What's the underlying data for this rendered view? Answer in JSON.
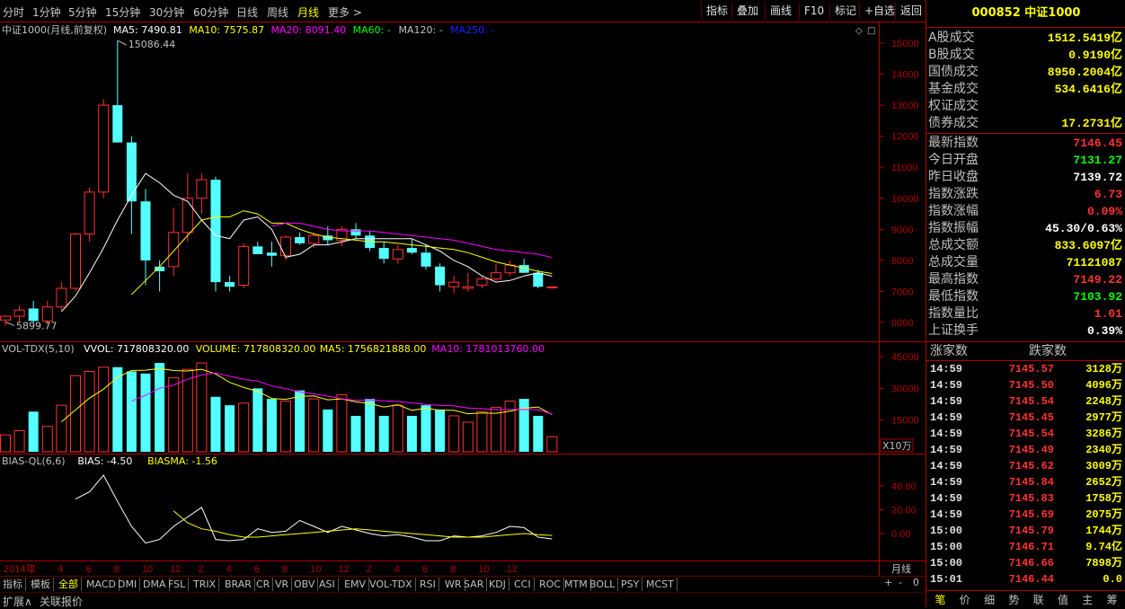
{
  "periods": [
    "分时",
    "1分钟",
    "5分钟",
    "15分钟",
    "30分钟",
    "60分钟",
    "日线",
    "周线",
    "月线",
    "更多"
  ],
  "active_period": "月线",
  "more_arrow": ">",
  "toolbar": [
    "指标",
    "叠加",
    "画线",
    "F10",
    "标记",
    "+自选",
    "返回"
  ],
  "chart": {
    "title": "中证1000(月线,前复权)",
    "ma_legend": [
      {
        "text": "MA5: 7490.81",
        "color": "#ffffff"
      },
      {
        "text": "MA10: 7575.87",
        "color": "#ffff00"
      },
      {
        "text": "MA20: 8091.40",
        "color": "#ff00ff"
      },
      {
        "text": "MA60: -",
        "color": "#00ff00"
      },
      {
        "text": "MA120: -",
        "color": "#c0c0c0"
      },
      {
        "text": "MA250: -",
        "color": "#2020ff"
      }
    ],
    "price_axis": [
      "15000",
      "14000",
      "13000",
      "12000",
      "11000",
      "10000",
      "9000",
      "8000",
      "7000",
      "6000"
    ],
    "high_label": "15086.44",
    "low_label": "5899.77",
    "vol_legend": [
      {
        "text": "VOL-TDX(5,10)",
        "color": "#c0c0c0"
      },
      {
        "text": "VVOL: 717808320.00",
        "color": "#ffffff"
      },
      {
        "text": "VOLUME: 717808320.00",
        "color": "#ffff00"
      },
      {
        "text": "MA5: 1756821888.00",
        "color": "#ffff00"
      },
      {
        "text": "MA10: 1781013760.00",
        "color": "#ff00ff"
      }
    ],
    "vol_axis": [
      "45000",
      "30000",
      "15000"
    ],
    "vol_unit": "X10万",
    "bias_legend": [
      {
        "text": "BIAS-QL(6,6)",
        "color": "#c0c0c0"
      },
      {
        "text": "BIAS: -4.50",
        "color": "#ffffff"
      },
      {
        "text": "BIASMA: -1.56",
        "color": "#ffff00"
      }
    ],
    "bias_axis": [
      "40.00",
      "20.00",
      "0.00"
    ],
    "x_axis": [
      "2014年",
      "2",
      "4",
      "6",
      "8",
      "10",
      "12",
      "2",
      "4",
      "6",
      "8",
      "10",
      "12",
      "2",
      "4",
      "6",
      "8",
      "10",
      "12"
    ],
    "period_label": "月线",
    "zoom_controls": [
      "+",
      "-",
      "0"
    ]
  },
  "chart_data": {
    "type": "candlestick",
    "title": "中证1000(月线,前复权)",
    "candles": [
      {
        "o": 6080,
        "h": 6250,
        "l": 5900,
        "c": 6200
      },
      {
        "o": 6200,
        "h": 6550,
        "l": 6000,
        "c": 6400
      },
      {
        "o": 6450,
        "h": 6700,
        "l": 6000,
        "c": 6050
      },
      {
        "o": 6050,
        "h": 6700,
        "l": 5950,
        "c": 6500
      },
      {
        "o": 6500,
        "h": 7300,
        "l": 6400,
        "c": 7100
      },
      {
        "o": 7100,
        "h": 8900,
        "l": 7000,
        "c": 8850
      },
      {
        "o": 8850,
        "h": 10350,
        "l": 8600,
        "c": 10200
      },
      {
        "o": 10200,
        "h": 13200,
        "l": 10000,
        "c": 13000
      },
      {
        "o": 13000,
        "h": 15086,
        "l": 11800,
        "c": 11800
      },
      {
        "o": 11800,
        "h": 12000,
        "l": 8850,
        "c": 9900
      },
      {
        "o": 9900,
        "h": 10300,
        "l": 7200,
        "c": 8000
      },
      {
        "o": 7800,
        "h": 8000,
        "l": 7000,
        "c": 7650
      },
      {
        "o": 7800,
        "h": 9700,
        "l": 7500,
        "c": 8900
      },
      {
        "o": 8900,
        "h": 10800,
        "l": 8600,
        "c": 10000
      },
      {
        "o": 10000,
        "h": 10800,
        "l": 9500,
        "c": 10600
      },
      {
        "o": 10600,
        "h": 10700,
        "l": 7000,
        "c": 7300
      },
      {
        "o": 7300,
        "h": 7500,
        "l": 7000,
        "c": 7150
      },
      {
        "o": 7200,
        "h": 8550,
        "l": 7100,
        "c": 8450
      },
      {
        "o": 8450,
        "h": 8600,
        "l": 8200,
        "c": 8200
      },
      {
        "o": 8250,
        "h": 8600,
        "l": 7800,
        "c": 8150
      },
      {
        "o": 8150,
        "h": 8800,
        "l": 8000,
        "c": 8750
      },
      {
        "o": 8750,
        "h": 8900,
        "l": 8500,
        "c": 8550
      },
      {
        "o": 8550,
        "h": 8900,
        "l": 8400,
        "c": 8800
      },
      {
        "o": 8800,
        "h": 9100,
        "l": 8500,
        "c": 8650
      },
      {
        "o": 8650,
        "h": 9100,
        "l": 8450,
        "c": 9000
      },
      {
        "o": 9000,
        "h": 9200,
        "l": 8700,
        "c": 8800
      },
      {
        "o": 8800,
        "h": 8950,
        "l": 8300,
        "c": 8400
      },
      {
        "o": 8400,
        "h": 8600,
        "l": 7900,
        "c": 8050
      },
      {
        "o": 8050,
        "h": 8500,
        "l": 7900,
        "c": 8350
      },
      {
        "o": 8400,
        "h": 8700,
        "l": 8200,
        "c": 8250
      },
      {
        "o": 8250,
        "h": 8500,
        "l": 7700,
        "c": 7800
      },
      {
        "o": 7800,
        "h": 7900,
        "l": 7000,
        "c": 7200
      },
      {
        "o": 7150,
        "h": 7500,
        "l": 6950,
        "c": 7300
      },
      {
        "o": 7100,
        "h": 7600,
        "l": 7000,
        "c": 7150
      },
      {
        "o": 7200,
        "h": 7500,
        "l": 7100,
        "c": 7400
      },
      {
        "o": 7400,
        "h": 7900,
        "l": 7300,
        "c": 7600
      },
      {
        "o": 7600,
        "h": 8000,
        "l": 7500,
        "c": 7850
      },
      {
        "o": 7850,
        "h": 8050,
        "l": 7600,
        "c": 7600
      },
      {
        "o": 7600,
        "h": 7700,
        "l": 7100,
        "c": 7150
      },
      {
        "o": 7140,
        "h": 7149,
        "l": 7104,
        "c": 7146
      }
    ],
    "ma5": [
      null,
      null,
      null,
      null,
      6350,
      6850,
      7600,
      8400,
      9300,
      10100,
      10800,
      10500,
      10100,
      9900,
      9300,
      8800,
      8700,
      9300,
      9400,
      9000,
      8100,
      8200,
      8500,
      8500,
      8600,
      8700,
      8700,
      8700,
      8700,
      8700,
      8500,
      8300,
      8000,
      7800,
      7500,
      7300,
      7350,
      7500,
      7600,
      7490
    ],
    "ma10": [
      null,
      null,
      null,
      null,
      null,
      null,
      null,
      null,
      null,
      6900,
      7350,
      7800,
      8300,
      8800,
      9300,
      9400,
      9400,
      9600,
      9500,
      9200,
      9200,
      9000,
      8850,
      8750,
      8700,
      8650,
      8600,
      8600,
      8550,
      8500,
      8450,
      8400,
      8350,
      8250,
      8100,
      7950,
      7850,
      7750,
      7650,
      7576
    ],
    "ma20": [
      null,
      null,
      null,
      null,
      null,
      null,
      null,
      null,
      null,
      null,
      null,
      null,
      null,
      null,
      null,
      null,
      null,
      null,
      null,
      9100,
      9200,
      9200,
      9100,
      9000,
      8950,
      8950,
      8950,
      8900,
      8850,
      8800,
      8750,
      8700,
      8650,
      8550,
      8450,
      8350,
      8300,
      8250,
      8200,
      8091
    ],
    "volume": [
      8000,
      10000,
      19000,
      12000,
      22000,
      36000,
      38000,
      40000,
      40000,
      38000,
      37000,
      42000,
      35000,
      39000,
      42000,
      26000,
      22000,
      23000,
      30000,
      25000,
      24000,
      29000,
      25000,
      20000,
      27000,
      17000,
      25000,
      17000,
      22000,
      17000,
      22000,
      20000,
      17000,
      14000,
      19000,
      21000,
      24000,
      25000,
      17000,
      7200
    ],
    "vol_ma5": [
      null,
      null,
      null,
      null,
      14200,
      19800,
      25400,
      29600,
      35200,
      38400,
      38600,
      39400,
      38400,
      38200,
      39000,
      36800,
      32800,
      30400,
      28600,
      25200,
      24800,
      26200,
      26400,
      24600,
      25000,
      23600,
      22800,
      21200,
      22200,
      19600,
      20600,
      19600,
      19600,
      18000,
      18400,
      18200,
      19200,
      20600,
      21200,
      17568
    ],
    "vol_ma10": [
      null,
      null,
      null,
      null,
      null,
      null,
      null,
      null,
      null,
      23900,
      26800,
      30000,
      31600,
      34300,
      36300,
      37300,
      35700,
      34300,
      33400,
      31100,
      29800,
      28300,
      27400,
      26300,
      25100,
      24300,
      24600,
      24100,
      23800,
      23100,
      22400,
      22000,
      21700,
      20700,
      20400,
      19900,
      20000,
      20100,
      19900,
      17810
    ],
    "bias": [
      null,
      null,
      null,
      null,
      null,
      29,
      35,
      49,
      27,
      6,
      -8,
      -5,
      6,
      14,
      22,
      -5,
      -6,
      -5,
      4,
      1,
      2,
      11,
      6,
      1,
      6,
      3,
      0,
      -2,
      -1,
      -3,
      -6,
      -6,
      -2,
      -3,
      -2,
      1,
      6,
      5,
      -3,
      -4.5
    ],
    "biasma": [
      null,
      null,
      null,
      null,
      null,
      null,
      null,
      null,
      null,
      null,
      null,
      null,
      19,
      9,
      4,
      2,
      -1,
      -3,
      -3,
      -2,
      -1,
      0,
      1,
      2,
      3,
      4,
      3,
      2,
      1,
      0,
      -1,
      -2,
      -3,
      -3,
      -3,
      -2,
      -1,
      0,
      -1,
      -1.56
    ]
  },
  "right_panel": {
    "title": "000852 中证1000",
    "turnover": [
      {
        "label": "A股成交",
        "value": "1512.5419亿",
        "color": "#ffff00"
      },
      {
        "label": "B股成交",
        "value": "0.9190亿",
        "color": "#ffff00"
      },
      {
        "label": "国债成交",
        "value": "8950.2004亿",
        "color": "#ffff00"
      },
      {
        "label": "基金成交",
        "value": "534.6416亿",
        "color": "#ffff00"
      },
      {
        "label": "权证成交",
        "value": "",
        "color": "#ffff00"
      },
      {
        "label": "债券成交",
        "value": "17.2731亿",
        "color": "#ffff00"
      }
    ],
    "quotes": [
      {
        "label": "最新指数",
        "value": "7146.45",
        "color": "#ff3232"
      },
      {
        "label": "今日开盘",
        "value": "7131.27",
        "color": "#00ff00"
      },
      {
        "label": "昨日收盘",
        "value": "7139.72",
        "color": "#ffffff"
      },
      {
        "label": "指数涨跌",
        "value": "6.73",
        "color": "#ff3232"
      },
      {
        "label": "指数涨幅",
        "value": "0.09%",
        "color": "#ff3232"
      },
      {
        "label": "指数振幅",
        "value": "45.30/0.63%",
        "color": "#ffffff"
      },
      {
        "label": "总成交额",
        "value": "833.6097亿",
        "color": "#ffff00"
      },
      {
        "label": "总成交量",
        "value": "71121087",
        "color": "#ffff00"
      },
      {
        "label": "最高指数",
        "value": "7149.22",
        "color": "#ff3232"
      },
      {
        "label": "最低指数",
        "value": "7103.92",
        "color": "#00ff00"
      },
      {
        "label": "指数量比",
        "value": "1.01",
        "color": "#ff3232"
      },
      {
        "label": "上证换手",
        "value": "0.39%",
        "color": "#ffffff"
      }
    ],
    "breadth": {
      "up_label": "涨家数",
      "down_label": "跌家数"
    },
    "ticks": [
      {
        "time": "14:59",
        "price": "7145.57",
        "vol": "3128万"
      },
      {
        "time": "14:59",
        "price": "7145.50",
        "vol": "4096万"
      },
      {
        "time": "14:59",
        "price": "7145.54",
        "vol": "2248万"
      },
      {
        "time": "14:59",
        "price": "7145.45",
        "vol": "2977万"
      },
      {
        "time": "14:59",
        "price": "7145.54",
        "vol": "3286万"
      },
      {
        "time": "14:59",
        "price": "7145.49",
        "vol": "2340万"
      },
      {
        "time": "14:59",
        "price": "7145.62",
        "vol": "3009万"
      },
      {
        "time": "14:59",
        "price": "7145.84",
        "vol": "2652万"
      },
      {
        "time": "14:59",
        "price": "7145.83",
        "vol": "1758万"
      },
      {
        "time": "14:59",
        "price": "7145.69",
        "vol": "2075万"
      },
      {
        "time": "15:00",
        "price": "7145.79",
        "vol": "1744万"
      },
      {
        "time": "15:00",
        "price": "7146.71",
        "vol": "9.74亿"
      },
      {
        "time": "15:00",
        "price": "7146.66",
        "vol": "7898万"
      },
      {
        "time": "15:01",
        "price": "7146.44",
        "vol": "0.0"
      }
    ],
    "bottom_tabs": [
      "笔",
      "价",
      "细",
      "势",
      "联",
      "值",
      "主",
      "筹"
    ]
  },
  "indicator_tabs": [
    "指标",
    "模板",
    "全部",
    "MACD",
    "DMI",
    "DMA",
    "FSL",
    "TRIX",
    "BRAR",
    "CR",
    "VR",
    "OBV",
    "ASI",
    "EMV",
    "VOL-TDX",
    "RSI",
    "WR",
    "SAR",
    "KDJ",
    "CCI",
    "ROC",
    "MTM",
    "BOLL",
    "PSY",
    "MCST"
  ],
  "active_indicator_tab": "全部",
  "status_items": [
    "扩展∧",
    "关联报价"
  ],
  "colors": {
    "up": "#ff3232",
    "down": "#54ffff",
    "border": "#b00000",
    "grid": "#600000"
  }
}
